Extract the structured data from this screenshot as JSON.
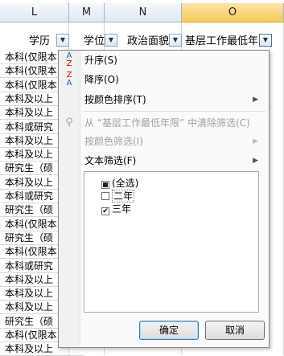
{
  "columns": [
    "L",
    "M",
    "N",
    "O"
  ],
  "selected_column": "O",
  "filter_headers": {
    "xueli": "学历",
    "xuewei": "学位",
    "zhengzhi": "政治面貌",
    "jiceng": "基层工作最低年限"
  },
  "cells": [
    "本科(仅限本",
    "本科(仅限本",
    "本科(仅限本",
    "本科及以上",
    "本科及以上",
    "本科或研究",
    "本科及以上",
    "本科及以上",
    "研究生（硕",
    "本科及以上",
    "本科或研究",
    "研究生（硕",
    "本科(仅限本",
    "研究生（硕",
    "本科(仅限本",
    "本科或研究",
    "本科及以上",
    "本科及以上",
    "本科及以上",
    "研究生（硕",
    "本科(仅限本",
    "本科及以上"
  ],
  "menu": {
    "sort_asc": "升序(S)",
    "sort_desc": "降序(O)",
    "sort_by_color": "按颜色排序(T)",
    "clear_filter": "从 “基层工作最低年限” 中清除筛选(C)",
    "filter_by_color": "按颜色筛选(I)",
    "text_filter": "文本筛选(F)",
    "list_items": [
      {
        "label": "(全选)",
        "state": "partial"
      },
      {
        "label": "二年",
        "state": "unchecked"
      },
      {
        "label": "三年",
        "state": "checked"
      }
    ],
    "ok": "确定",
    "cancel": "取消"
  },
  "icons": {
    "sort_asc_top": "A",
    "sort_asc_bottom": "Z",
    "sort_desc_top": "Z",
    "sort_desc_bottom": "A"
  }
}
